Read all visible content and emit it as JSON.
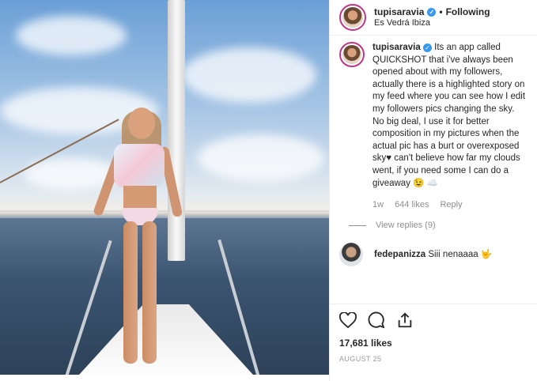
{
  "post": {
    "username": "tupisaravia",
    "following_label": "Following",
    "location": "Es Vedrá Ibiza",
    "likes": "17,681 likes",
    "date": "AUGUST 25"
  },
  "comments": [
    {
      "username": "tupisaravia",
      "text": "Its an app called QUICKSHOT that i've always been opened about with my followers, actually there is a highlighted story on my feed where you can see how I edit my followers pics changing the sky. No big deal, I use it for better composition in my pictures when the actual pic has a burt or overexposed sky♥ can't believe how far my clouds went, if you need some I can do a giveaway 😉 ☁️",
      "time": "1w",
      "likes": "644 likes",
      "reply_label": "Reply",
      "view_replies": "View replies (9)"
    },
    {
      "username": "fedepanizza",
      "text": "Siii nenaaaa 🤟"
    }
  ],
  "icons": [
    "heart-icon",
    "comment-icon",
    "share-icon"
  ],
  "colors": {
    "verified": "#3897f0",
    "story_ring": "#c13584",
    "muted_text": "#8e8e8e"
  }
}
